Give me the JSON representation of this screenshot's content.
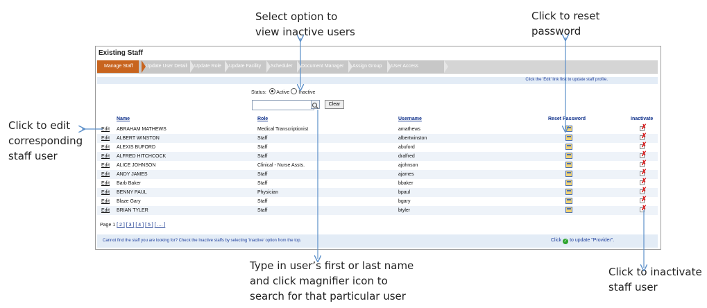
{
  "callouts": {
    "top": [
      "Select option to",
      "view inactive users"
    ],
    "reset": [
      "Click to reset",
      "password"
    ],
    "edit": [
      "Click to edit",
      "corresponding",
      "staff user"
    ],
    "search": [
      "Type in user’s first or last name",
      "and click magnifier icon to",
      "search for that particular user"
    ],
    "inactivate": [
      "Click to inactivate",
      "staff user"
    ]
  },
  "panel": {
    "title": "Existing Staff",
    "tabs": [
      "Manage Staff",
      "Update User Details",
      "Update Role",
      "Update Facility",
      "Scheduler",
      "Document Manager",
      "Assign Group",
      "User Access"
    ],
    "info": "Click the 'Edit' link first to update staff profile.",
    "status_label": "Status:",
    "status_options": [
      "Active",
      "Inactive"
    ],
    "search_placeholder": "",
    "clear_label": "Clear",
    "columns": {
      "name": "Name",
      "role": "Role",
      "username": "Username",
      "reset": "Reset Password",
      "inactivate": "Inactivate"
    },
    "edit_label": "Edit",
    "rows": [
      {
        "name": "ABRAHAM MATHEWS",
        "role": "Medical Transcriptionist",
        "username": "amathews"
      },
      {
        "name": "ALBERT WINSTON",
        "role": "Staff",
        "username": "albertwinston"
      },
      {
        "name": "ALEXIS BUFORD",
        "role": "Staff",
        "username": "abuford"
      },
      {
        "name": "ALFRED HITCHCOCK",
        "role": "Staff",
        "username": "dralfred"
      },
      {
        "name": "ALICE JOHNSON",
        "role": "Clinical - Nurse Assts.",
        "username": "ajohnson"
      },
      {
        "name": "ANDY JAMES",
        "role": "Staff",
        "username": "ajames"
      },
      {
        "name": "Barb Baker",
        "role": "Staff",
        "username": "bbaker"
      },
      {
        "name": "BENNY PAUL",
        "role": "Physician",
        "username": "bpaul"
      },
      {
        "name": "Blaze Gary",
        "role": "Staff",
        "username": "bgary"
      },
      {
        "name": "BRIAN TYLER",
        "role": "Staff",
        "username": "btyler"
      }
    ],
    "pager_prefix": "Page 1",
    "pages": [
      "[ 2 ]",
      "[ 3 ]",
      "[ 4 ]",
      "[ 5 ]",
      "[ .... ]"
    ],
    "footer": "Cannot find the staff you are looking for? Check the Inactive staffs by selecting 'Inactive' option from the top.",
    "provider_prefix": "Click",
    "provider_suffix": "to update \"Provider\"."
  },
  "colors": {
    "active_tab": "#c8641e",
    "link": "#0d2f8a",
    "info": "#1c3d9c",
    "callout_arrow": "#5b8fc9"
  }
}
